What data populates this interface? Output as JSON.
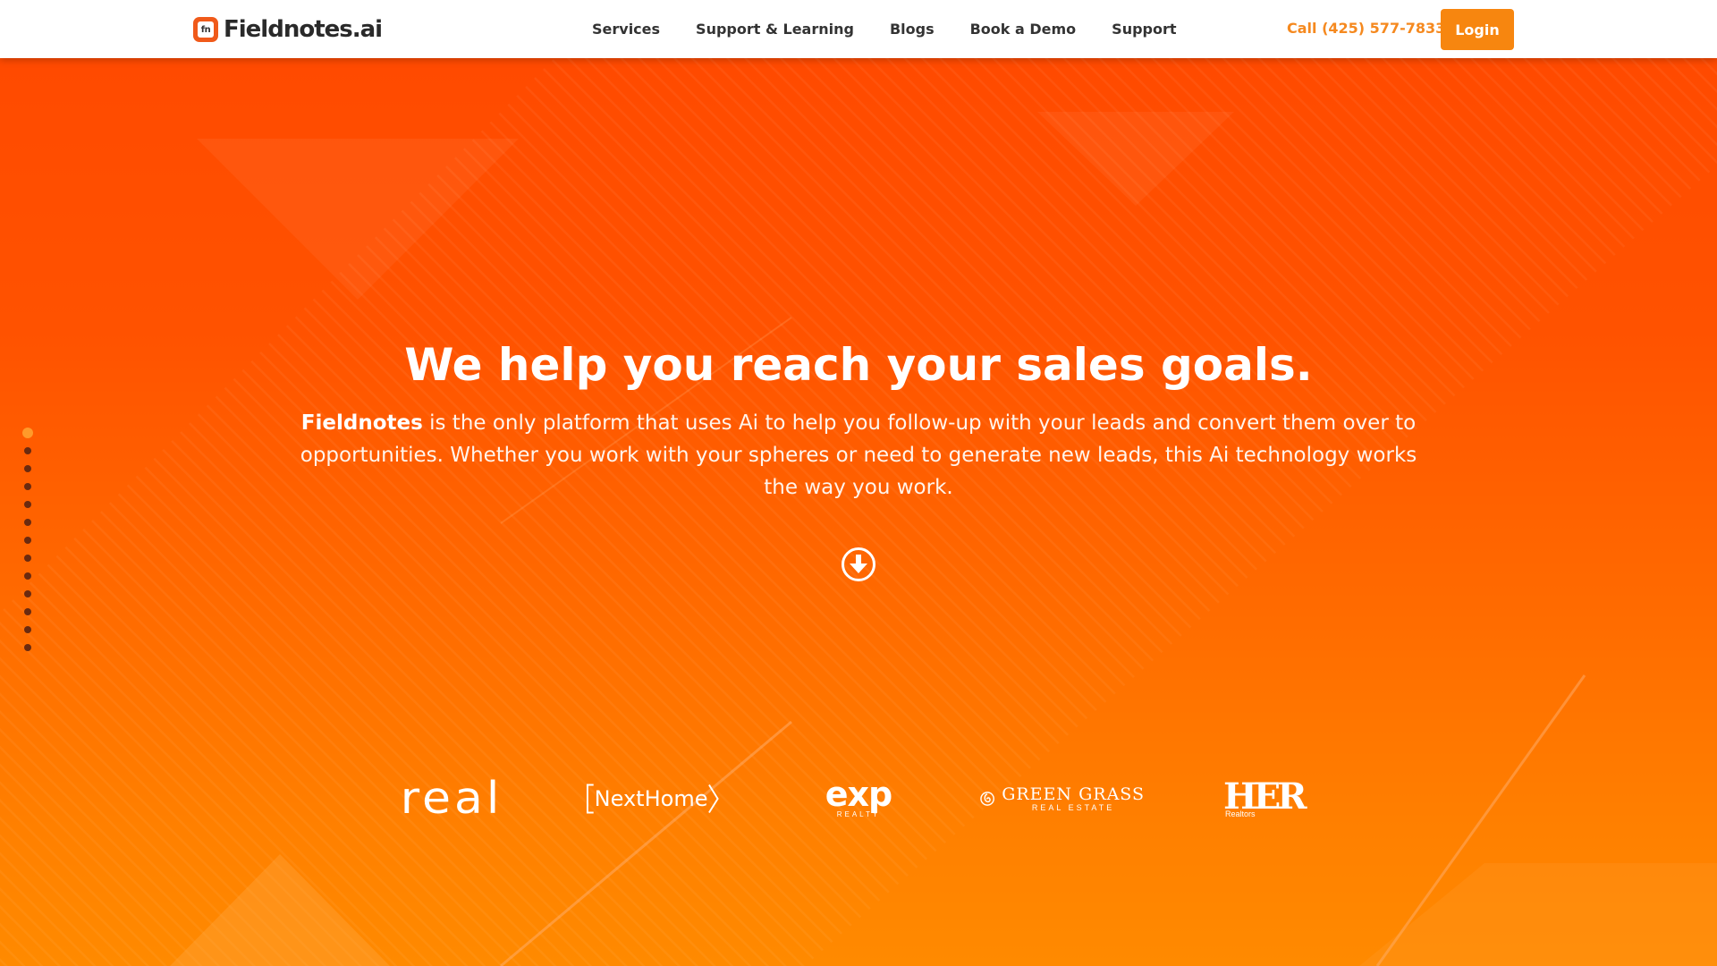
{
  "header": {
    "logo_text": "Fieldnotes.ai",
    "logo_mark": "fn",
    "nav": [
      {
        "label": "Services"
      },
      {
        "label": "Support & Learning"
      },
      {
        "label": "Blogs"
      },
      {
        "label": "Book a Demo"
      },
      {
        "label": "Support"
      }
    ],
    "call_label": "Call (425) 577-7833",
    "login_label": "Login"
  },
  "hero": {
    "headline": "We help you reach your sales goals.",
    "sub_bold": "Fieldnotes",
    "sub_rest": " is the only platform that uses Ai to help you follow-up with your leads and convert them over to opportunities. Whether you work with your spheres or need to generate new leads, this Ai technology works the way you work.",
    "scroll_icon": "arrow-down-circle-icon",
    "slide_count": 13,
    "active_slide": 1
  },
  "partners": {
    "real": "real",
    "nexthome": "NextHome",
    "exp_main": "exp",
    "exp_sub": "REALTY",
    "gg_main": "GREEN GRASS",
    "gg_sub": "REAL ESTATE",
    "her_main": "HER",
    "her_sub": "Realtors"
  },
  "colors": {
    "brand_orange": "#f7860f",
    "call_orange": "#f5891f",
    "hero_top": "#ff4a00",
    "hero_bottom": "#ff8a00"
  }
}
